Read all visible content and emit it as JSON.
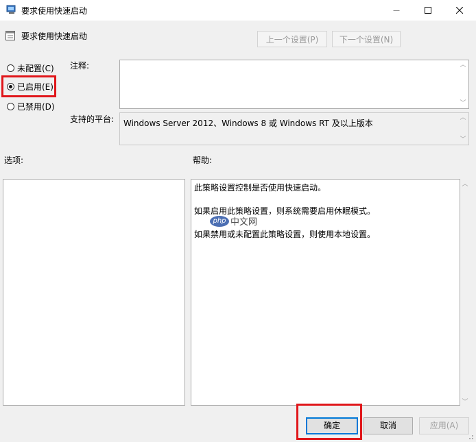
{
  "window": {
    "title": "要求使用快速启动",
    "controls": {
      "minimize": "—",
      "maximize": "☐",
      "close": "✕"
    }
  },
  "header": {
    "policy_name": "要求使用快速启动",
    "prev_label": "上一个设置(P)",
    "next_label": "下一个设置(N)"
  },
  "state": {
    "options": [
      {
        "label": "未配置(C)",
        "checked": false
      },
      {
        "label": "已启用(E)",
        "checked": true
      },
      {
        "label": "已禁用(D)",
        "checked": false
      }
    ]
  },
  "comment": {
    "label": "注释:",
    "value": ""
  },
  "platform": {
    "label": "支持的平台:",
    "value": "Windows Server 2012、Windows 8 或 Windows RT 及以上版本"
  },
  "options_section": {
    "label": "选项:"
  },
  "help": {
    "label": "帮助:",
    "lines": [
      "此策略设置控制是否使用快速启动。",
      "如果启用此策略设置，则系统需要启用休眠模式。",
      "如果禁用或未配置此策略设置，则使用本地设置。"
    ]
  },
  "watermark": {
    "logo": "php",
    "text": "中文网"
  },
  "buttons": {
    "ok": "确定",
    "cancel": "取消",
    "apply": "应用(A)"
  },
  "colors": {
    "highlight": "#e0161a",
    "focus": "#0078d7"
  }
}
